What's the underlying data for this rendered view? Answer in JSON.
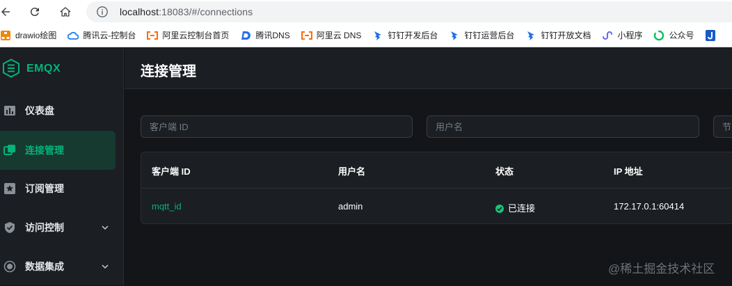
{
  "browser": {
    "url_host": "localhost",
    "url_rest": ":18083/#/connections",
    "bookmarks": [
      {
        "label": "drawio绘图",
        "icon": "drawio-icon"
      },
      {
        "label": "腾讯云-控制台",
        "icon": "tencent-cloud-icon"
      },
      {
        "label": "阿里云控制台首页",
        "icon": "aliyun-icon"
      },
      {
        "label": "腾讯DNS",
        "icon": "dnspod-icon"
      },
      {
        "label": "阿里云 DNS",
        "icon": "aliyun-icon"
      },
      {
        "label": "钉钉开发后台",
        "icon": "dingtalk-icon"
      },
      {
        "label": "钉钉运营后台",
        "icon": "dingtalk-icon"
      },
      {
        "label": "钉钉开放文档",
        "icon": "dingtalk-icon"
      },
      {
        "label": "小程序",
        "icon": "miniprogram-icon"
      },
      {
        "label": "公众号",
        "icon": "wechat-icon"
      },
      {
        "label": "",
        "icon": "j-icon"
      }
    ]
  },
  "brand": {
    "name": "EMQX",
    "color": "#02b47a"
  },
  "sidebar": {
    "items": [
      {
        "label": "仪表盘",
        "icon": "dashboard-icon"
      },
      {
        "label": "连接管理",
        "icon": "connections-icon",
        "active": true
      },
      {
        "label": "订阅管理",
        "icon": "subscriptions-icon"
      },
      {
        "label": "访问控制",
        "icon": "shield-icon",
        "expandable": true
      },
      {
        "label": "数据集成",
        "icon": "integration-icon",
        "expandable": true
      }
    ]
  },
  "header": {
    "title": "连接管理"
  },
  "filters": {
    "client_id_placeholder": "客户端 ID",
    "username_placeholder": "用户名",
    "node_placeholder": "节点"
  },
  "table": {
    "columns": [
      "客户端 ID",
      "用户名",
      "状态",
      "IP 地址"
    ],
    "rows": [
      {
        "client_id": "mqtt_id",
        "username": "admin",
        "status": "已连接",
        "ip": "172.17.0.1:60414"
      }
    ]
  },
  "watermark": "@稀土掘金技术社区"
}
